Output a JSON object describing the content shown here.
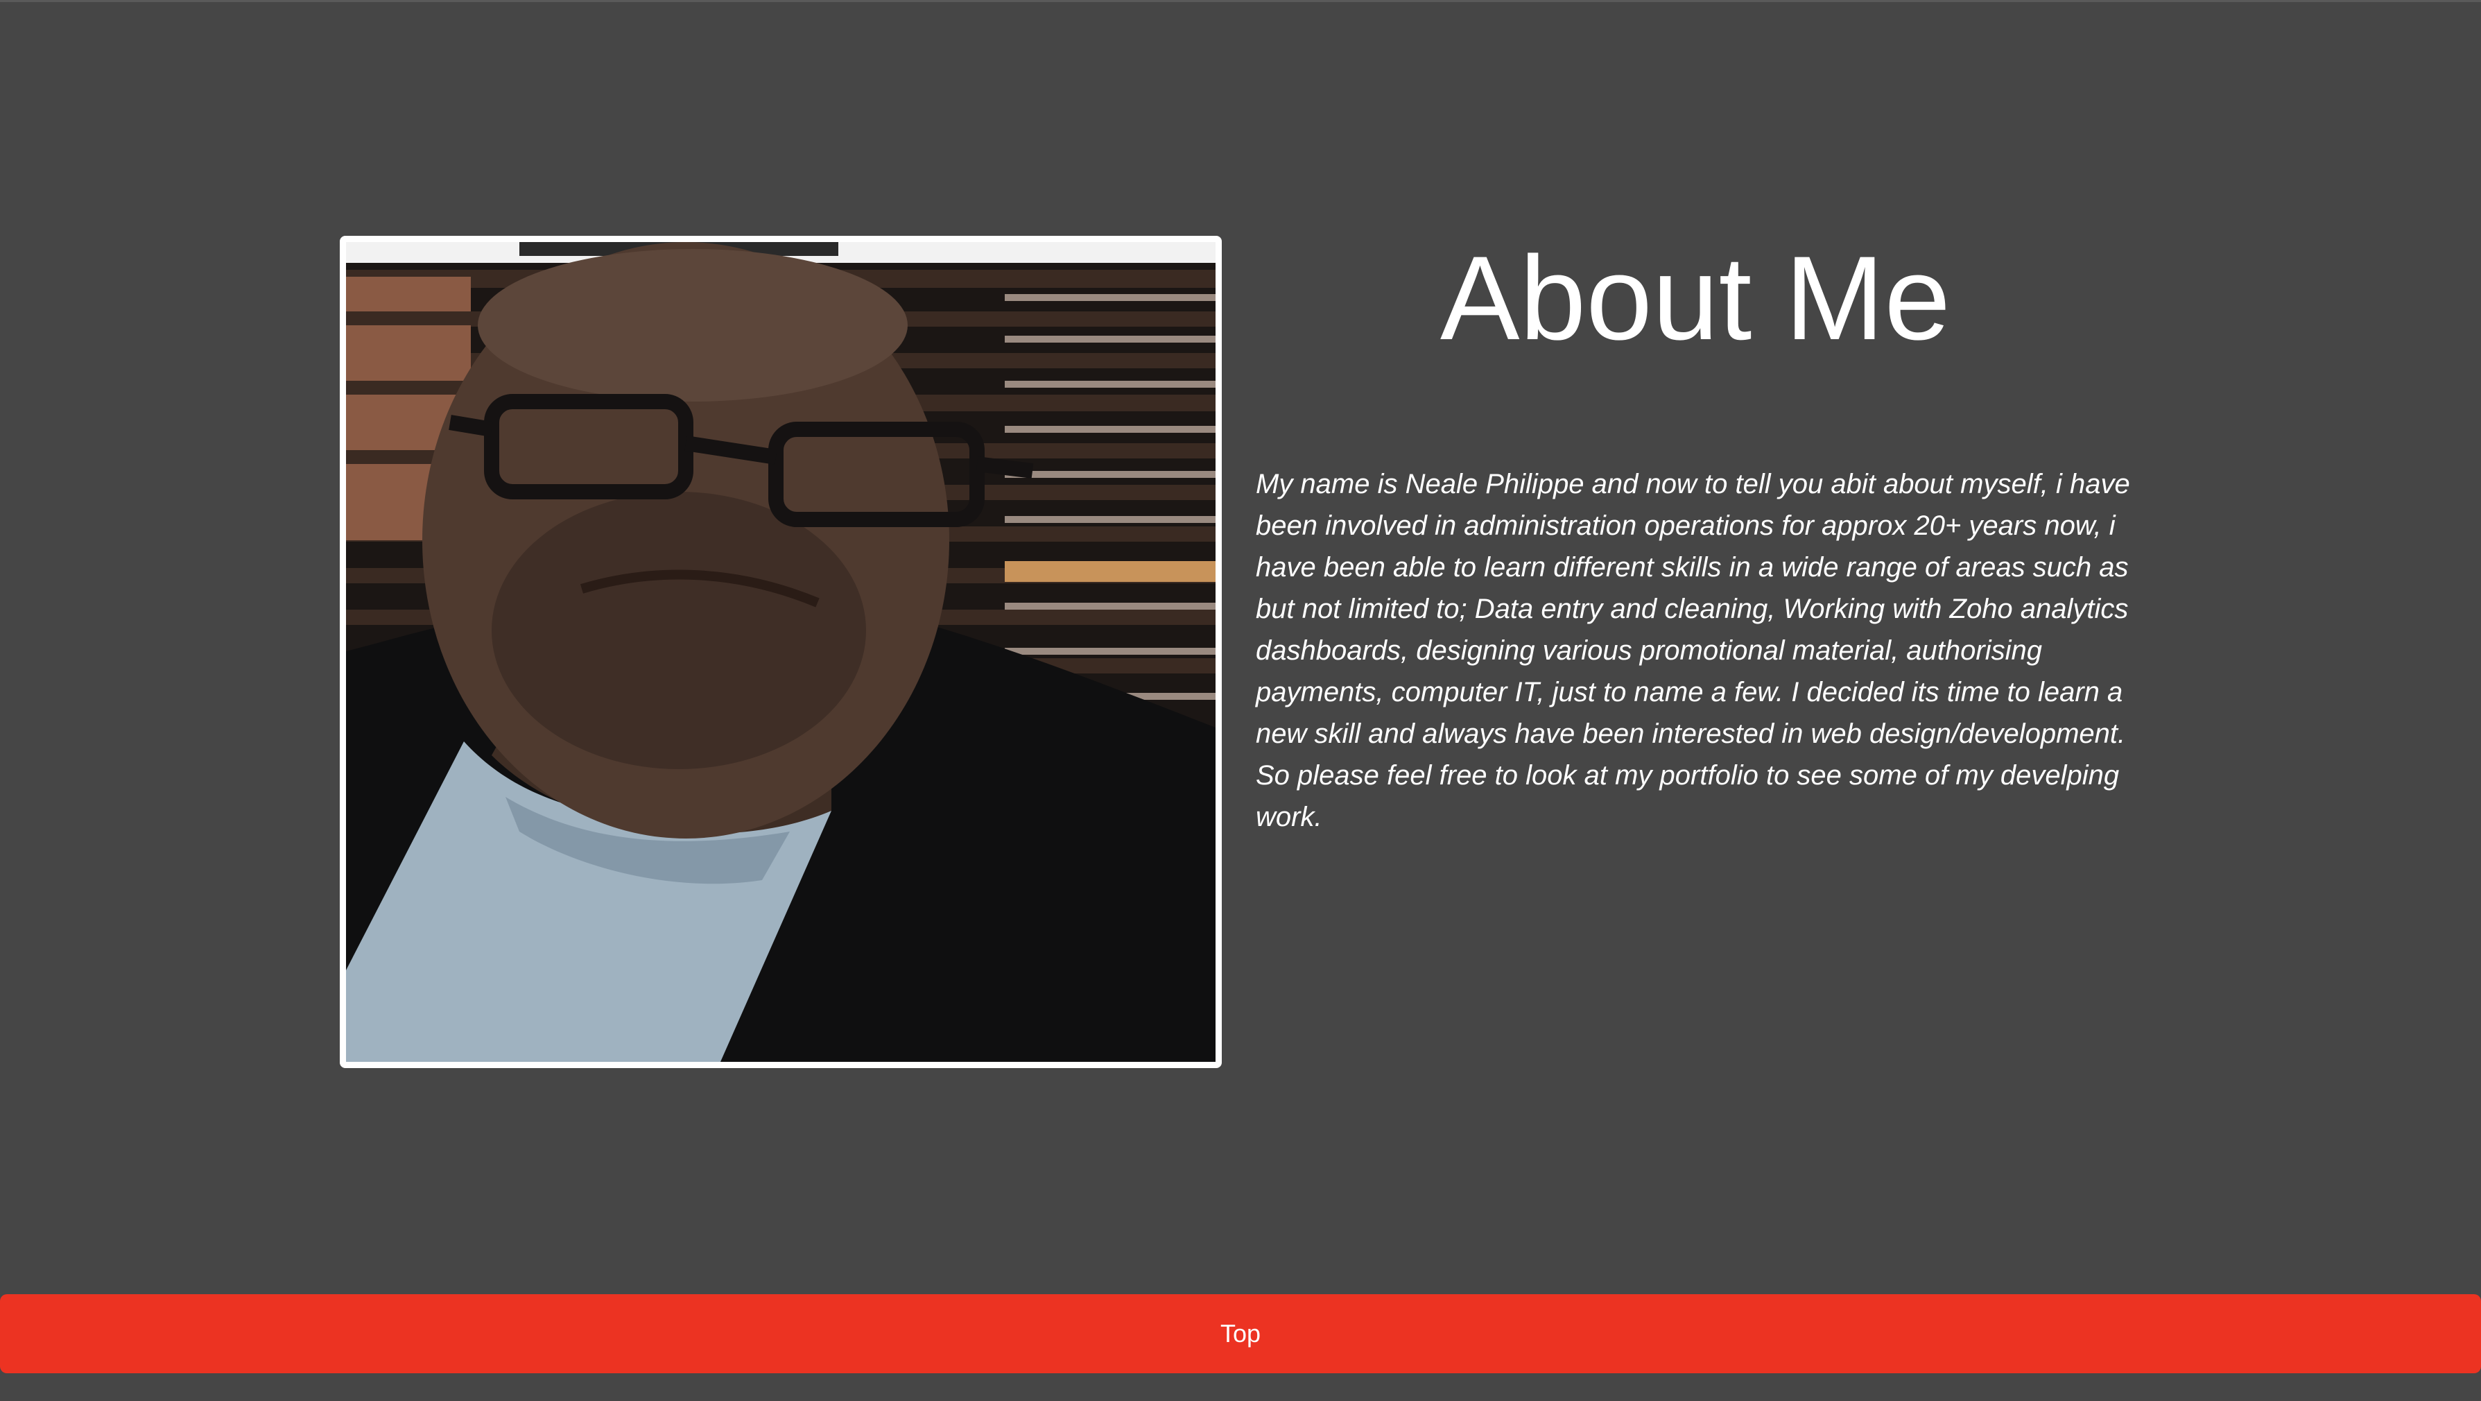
{
  "about": {
    "title": "About Me",
    "bio": "My name is Neale Philippe and now to tell you abit about myself, i have been involved in administration operations for approx 20+ years now, i have been able to learn different skills in a wide range of areas such as but not limited to; Data entry and cleaning, Working with Zoho analytics dashboards, designing various promotional material, authorising payments, computer IT, just to name a few. I decided its time to learn a new skill and always have been interested in web design/development. So please feel free to look at my portfolio to see some of my develping work."
  },
  "footer": {
    "top_label": "Top"
  },
  "colors": {
    "background": "#464646",
    "accent": "#ec3322",
    "text": "#ffffff"
  }
}
